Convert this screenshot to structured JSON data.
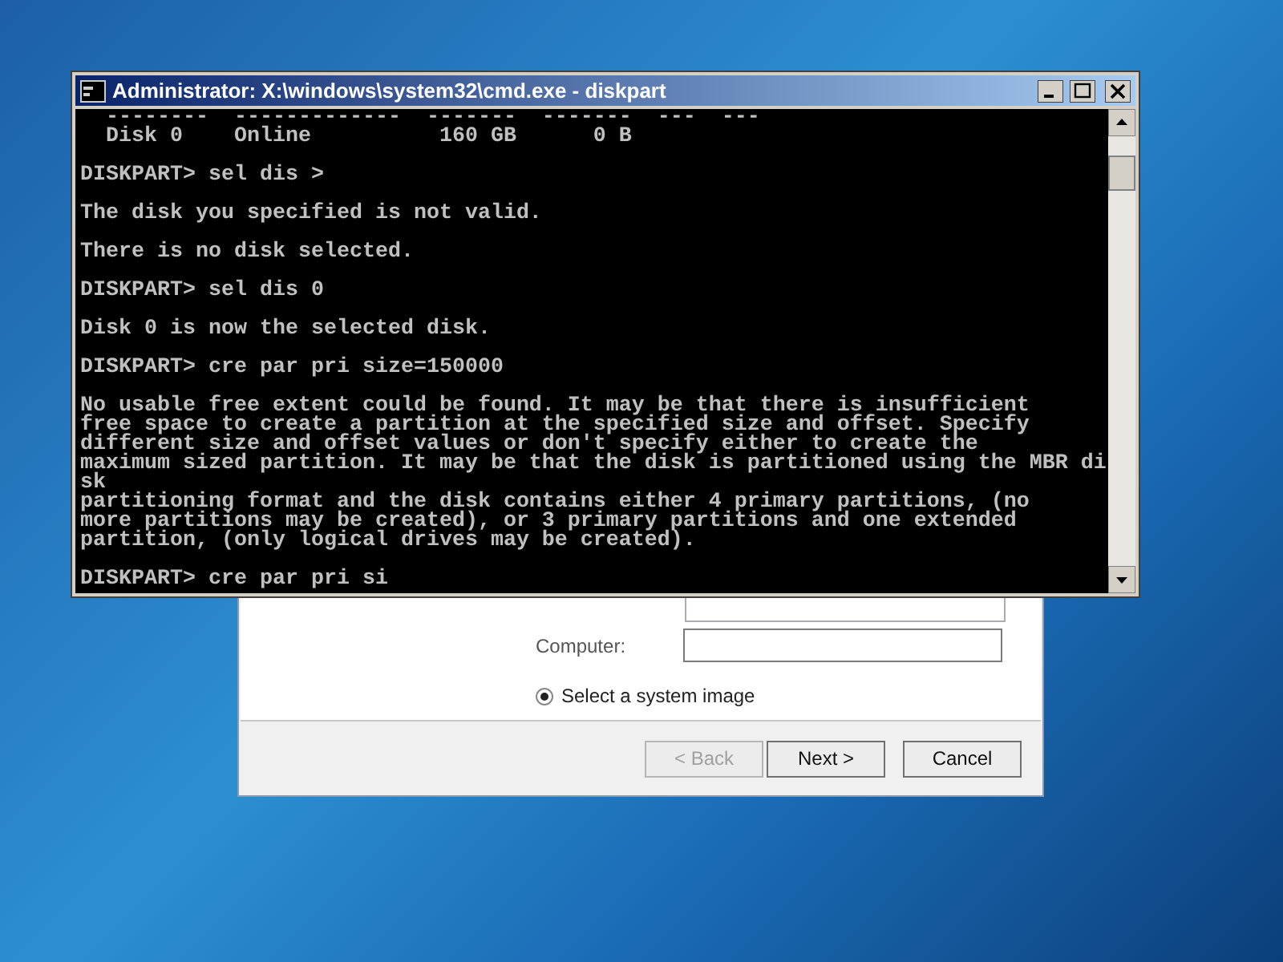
{
  "console": {
    "title": "Administrator: X:\\windows\\system32\\cmd.exe - diskpart",
    "output": [
      [
        "  --------  -------------  -------  -------  ---  ---",
        "  Disk 0    Online          160 GB      0 B"
      ],
      [
        "DISKPART> sel dis >"
      ],
      [
        "The disk you specified is not valid."
      ],
      [
        "There is no disk selected."
      ],
      [
        "DISKPART> sel dis 0"
      ],
      [
        "Disk 0 is now the selected disk."
      ],
      [
        "DISKPART> cre par pri size=150000"
      ],
      [
        "No usable free extent could be found. It may be that there is insufficient",
        "free space to create a partition at the specified size and offset. Specify",
        "different size and offset values or don't specify either to create the",
        "maximum sized partition. It may be that the disk is partitioned using the MBR di",
        "sk",
        "partitioning format and the disk contains either 4 primary partitions, (no",
        "more partitions may be created), or 3 primary partitions and one extended",
        "partition, (only logical drives may be created)."
      ],
      [
        "DISKPART> cre par pri si"
      ]
    ]
  },
  "dialog": {
    "fields": [
      {
        "label": "Computer:"
      }
    ],
    "radio": {
      "label": "Select a system image",
      "selected": true
    },
    "buttons": [
      {
        "label": "< Back",
        "disabled": true
      },
      {
        "label": "Next >",
        "disabled": false
      },
      {
        "label": "Cancel",
        "disabled": false
      }
    ]
  }
}
